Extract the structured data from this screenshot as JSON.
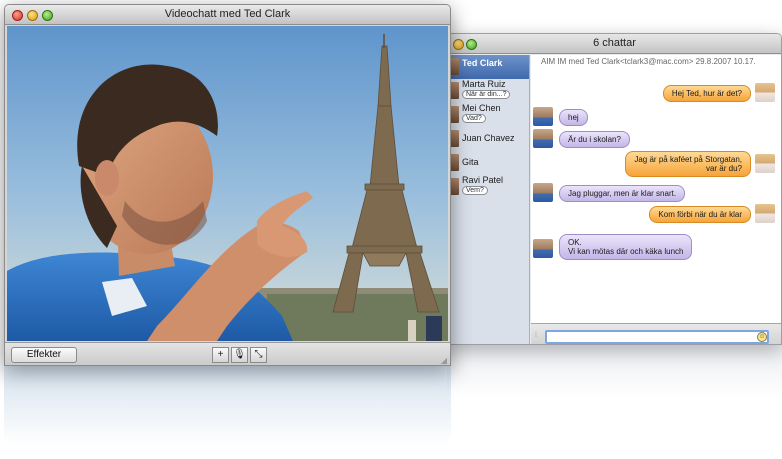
{
  "chat_window": {
    "title": "6 chattar",
    "header": "AIM IM med Ted Clark<tclark3@mac.com> 29.8.2007 10.17.",
    "buddies": [
      {
        "name": "Ted Clark",
        "preview": ""
      },
      {
        "name": "Marta Ruiz",
        "preview": "När är din...?"
      },
      {
        "name": "Mei Chen",
        "preview": "Vad?"
      },
      {
        "name": "Juan Chavez",
        "preview": ""
      },
      {
        "name": "Gita",
        "preview": ""
      },
      {
        "name": "Ravi Patel",
        "preview": "Vem?"
      }
    ],
    "messages": [
      {
        "text": "Hej Ted, hur är det?"
      },
      {
        "text": "hej"
      },
      {
        "text": "Är du i skolan?"
      },
      {
        "line1": "Jag är på kaféet på Storgatan,",
        "line2": "var är du?"
      },
      {
        "text": "Jag pluggar, men är klar snart."
      },
      {
        "text": "Kom förbi när du är klar"
      },
      {
        "line1": "OK.",
        "line2": "Vi kan mötas där och käka lunch"
      }
    ],
    "input_value": ""
  },
  "video_window": {
    "title": "Videochatt med Ted Clark",
    "effects_label": "Effekter",
    "controls": [
      {
        "icon": "add-icon",
        "glyph": "+"
      },
      {
        "icon": "microphone-icon",
        "glyph": "🎙"
      },
      {
        "icon": "fullscreen-icon",
        "glyph": "⤡"
      }
    ]
  }
}
